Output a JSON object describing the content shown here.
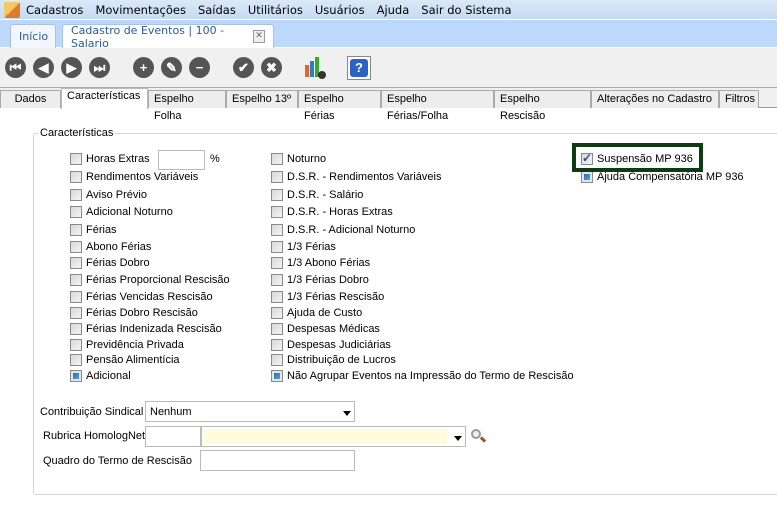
{
  "menu": [
    "Cadastros",
    "Movimentações",
    "Saídas",
    "Utilitários",
    "Usuários",
    "Ajuda",
    "Sair do Sistema"
  ],
  "doc_tabs": {
    "home": "Início",
    "current": "Cadastro de Eventos | 100 - Salario"
  },
  "page_tabs": [
    "Dados",
    "Características",
    "Espelho Folha",
    "Espelho 13º",
    "Espelho Férias",
    "Espelho Férias/Folha",
    "Espelho Rescisão",
    "Alterações no Cadastro",
    "Filtros"
  ],
  "group_title": "Características",
  "percent_sign": "%",
  "left_col": [
    {
      "label": "Horas Extras",
      "state": "unchecked"
    },
    {
      "label": "Rendimentos Variáveis",
      "state": "unchecked"
    },
    {
      "label": "Aviso Prévio",
      "state": "unchecked"
    },
    {
      "label": "Adicional Noturno",
      "state": "unchecked"
    },
    {
      "label": "Férias",
      "state": "unchecked"
    },
    {
      "label": "Abono Férias",
      "state": "unchecked"
    },
    {
      "label": "Férias Dobro",
      "state": "unchecked"
    },
    {
      "label": "Férias Proporcional Rescisão",
      "state": "unchecked"
    },
    {
      "label": "Férias Vencidas Rescisão",
      "state": "unchecked"
    },
    {
      "label": "Férias Dobro Rescisão",
      "state": "unchecked"
    },
    {
      "label": "Férias Indenizada Rescisão",
      "state": "unchecked"
    },
    {
      "label": "Previdência Privada",
      "state": "unchecked"
    },
    {
      "label": "Pensão Alimentícia",
      "state": "unchecked"
    },
    {
      "label": "Adicional",
      "state": "indeterminate"
    }
  ],
  "mid_col": [
    {
      "label": "Noturno",
      "state": "unchecked"
    },
    {
      "label": "D.S.R. - Rendimentos Variáveis",
      "state": "unchecked"
    },
    {
      "label": "D.S.R. - Salário",
      "state": "unchecked"
    },
    {
      "label": "D.S.R. - Horas Extras",
      "state": "unchecked"
    },
    {
      "label": "D.S.R. - Adicional Noturno",
      "state": "unchecked"
    },
    {
      "label": "1/3 Férias",
      "state": "unchecked"
    },
    {
      "label": "1/3 Abono Férias",
      "state": "unchecked"
    },
    {
      "label": "1/3 Férias Dobro",
      "state": "unchecked"
    },
    {
      "label": "1/3 Férias Rescisão",
      "state": "unchecked"
    },
    {
      "label": "Ajuda de Custo",
      "state": "unchecked"
    },
    {
      "label": "Despesas Médicas",
      "state": "unchecked"
    },
    {
      "label": "Despesas Judiciárias",
      "state": "unchecked"
    },
    {
      "label": "Distribuição de Lucros",
      "state": "unchecked"
    },
    {
      "label": "Não Agrupar Eventos na Impressão do Termo de Rescisão",
      "state": "indeterminate"
    }
  ],
  "right_col": [
    {
      "label": "Suspensão MP 936",
      "state": "checked"
    },
    {
      "label": "Ajuda Compensatória MP 936",
      "state": "indeterminate"
    }
  ],
  "form": {
    "contrib_label": "Contribuição Sindical",
    "contrib_value": "Nenhum",
    "rubrica_label": "Rubrica HomologNet",
    "quadro_label": "Quadro do Termo de Rescisão"
  }
}
